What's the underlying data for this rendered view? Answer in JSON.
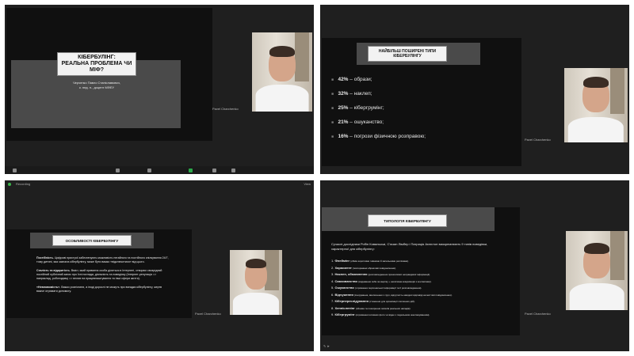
{
  "participant": {
    "name": "Pavel Charchenko"
  },
  "topbar": {
    "recording_label": "Recording",
    "view_label": "View"
  },
  "slide1": {
    "title_line1": "КІБЕРБУЛІНГ:",
    "title_line2": "РЕАЛЬНА ПРОБЛЕМА ЧИ МІФ?",
    "author_line1": "Черченко Павло Станіславович,",
    "author_line2": "к. пед. н., доцент МФЕУ"
  },
  "slide2": {
    "title_line1": "НАЙБІЛЬШ ПОШИРЕНІ ТИПИ",
    "title_line2": "КІБЕРБУЛІНГУ",
    "items": [
      {
        "pct": "42%",
        "text": "– образи;"
      },
      {
        "pct": "32%",
        "text": "– наклеп;"
      },
      {
        "pct": "25%",
        "text": "– кібергрумінг;"
      },
      {
        "pct": "21%",
        "text": "– ошуканство;"
      },
      {
        "pct": "16%",
        "text": "– погрози фізичною розправою;"
      }
    ]
  },
  "slide3": {
    "title": "ОСОБЛИВОСТІ КІБЕРБУЛІНГУ",
    "p1_bold": "Постійність.",
    "p1": "Цифрові пристрої забезпечують можливість негайного та постійного спілкування 24/7, тому дитині, яка зазнала кібербулінгу, може бути важко «відключитися» від цього.",
    "p2_bold": "Сталість та відкритість.",
    "p2": "Вміст, який приватна особа ділиться в Інтернеті, створює своєрідний постійний публічний запис про їхні погляди, діяльність та поведінку (Інтернет-репутація => наприклад, роботодавці => вплив на працевлаштування та інші сфери життя).",
    "p3_bold": "«Невловимість».",
    "p3": "Важко розпізнати, а іноді дорослі не можуть про вигадки кібербулінгу, жертв важче отримати допомогу."
  },
  "slide4": {
    "title": "ТИПОЛОГІЯ КІБЕРБУЛІНГУ",
    "intro": "Сучасні дослідники Робін Ковальські, С'юзан Лімбер і Патриція Агатстон виокремлюють 9 типів поведінки, характерної для кібербулінгу:",
    "items": [
      {
        "n": "1.",
        "term": "Флеймінг",
        "desc": "(обмін короткими гнівними й запальними репліками)."
      },
      {
        "n": "2.",
        "term": "Харасмент",
        "desc": "(повторювані образливі повідомлення)."
      },
      {
        "n": "3.",
        "term": "Наклеп, обмовлення",
        "desc": "(розповсюдження принизливої неправдивої інформації)."
      },
      {
        "n": "4.",
        "term": "Самозванство",
        "desc": "(видавання себе за жертву + негативна комунікація з контактами)."
      },
      {
        "n": "5.",
        "term": "Ошуканство",
        "desc": "(отримання персональної інформації та її розповсюдження)."
      },
      {
        "n": "6.",
        "term": "Відчуження",
        "desc": "(ігнорування, виключення з груп, відсутність швидкої відповіді на миттєві повідомлення)."
      },
      {
        "n": "7.",
        "term": "Кіберпереслідування",
        "desc": "(стеження для організації злочинних дій)."
      },
      {
        "n": "8.",
        "term": "Хеппіслепінг",
        "desc": "(зйомка та поширення записів реальних нападів)."
      },
      {
        "n": "9.",
        "term": "Кібергрумінг",
        "desc": "(отримання інтимних фото чи відео з подальшим шантажуванням)."
      }
    ]
  }
}
